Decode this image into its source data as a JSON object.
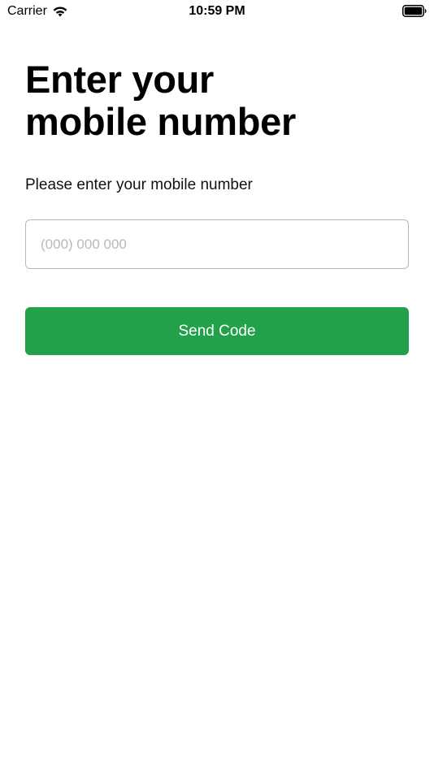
{
  "status_bar": {
    "carrier": "Carrier",
    "time": "10:59 PM",
    "wifi_icon": "wifi-icon",
    "battery_icon": "battery-full-icon"
  },
  "main": {
    "title": "Enter your\nmobile number",
    "subtitle": "Please enter your mobile number",
    "phone_input": {
      "value": "",
      "placeholder": "(000) 000 000"
    },
    "send_button_label": "Send Code"
  },
  "colors": {
    "accent": "#22a04a",
    "input_border": "#b8b8b8",
    "placeholder": "#b8b8b8",
    "background": "#ffffff"
  }
}
